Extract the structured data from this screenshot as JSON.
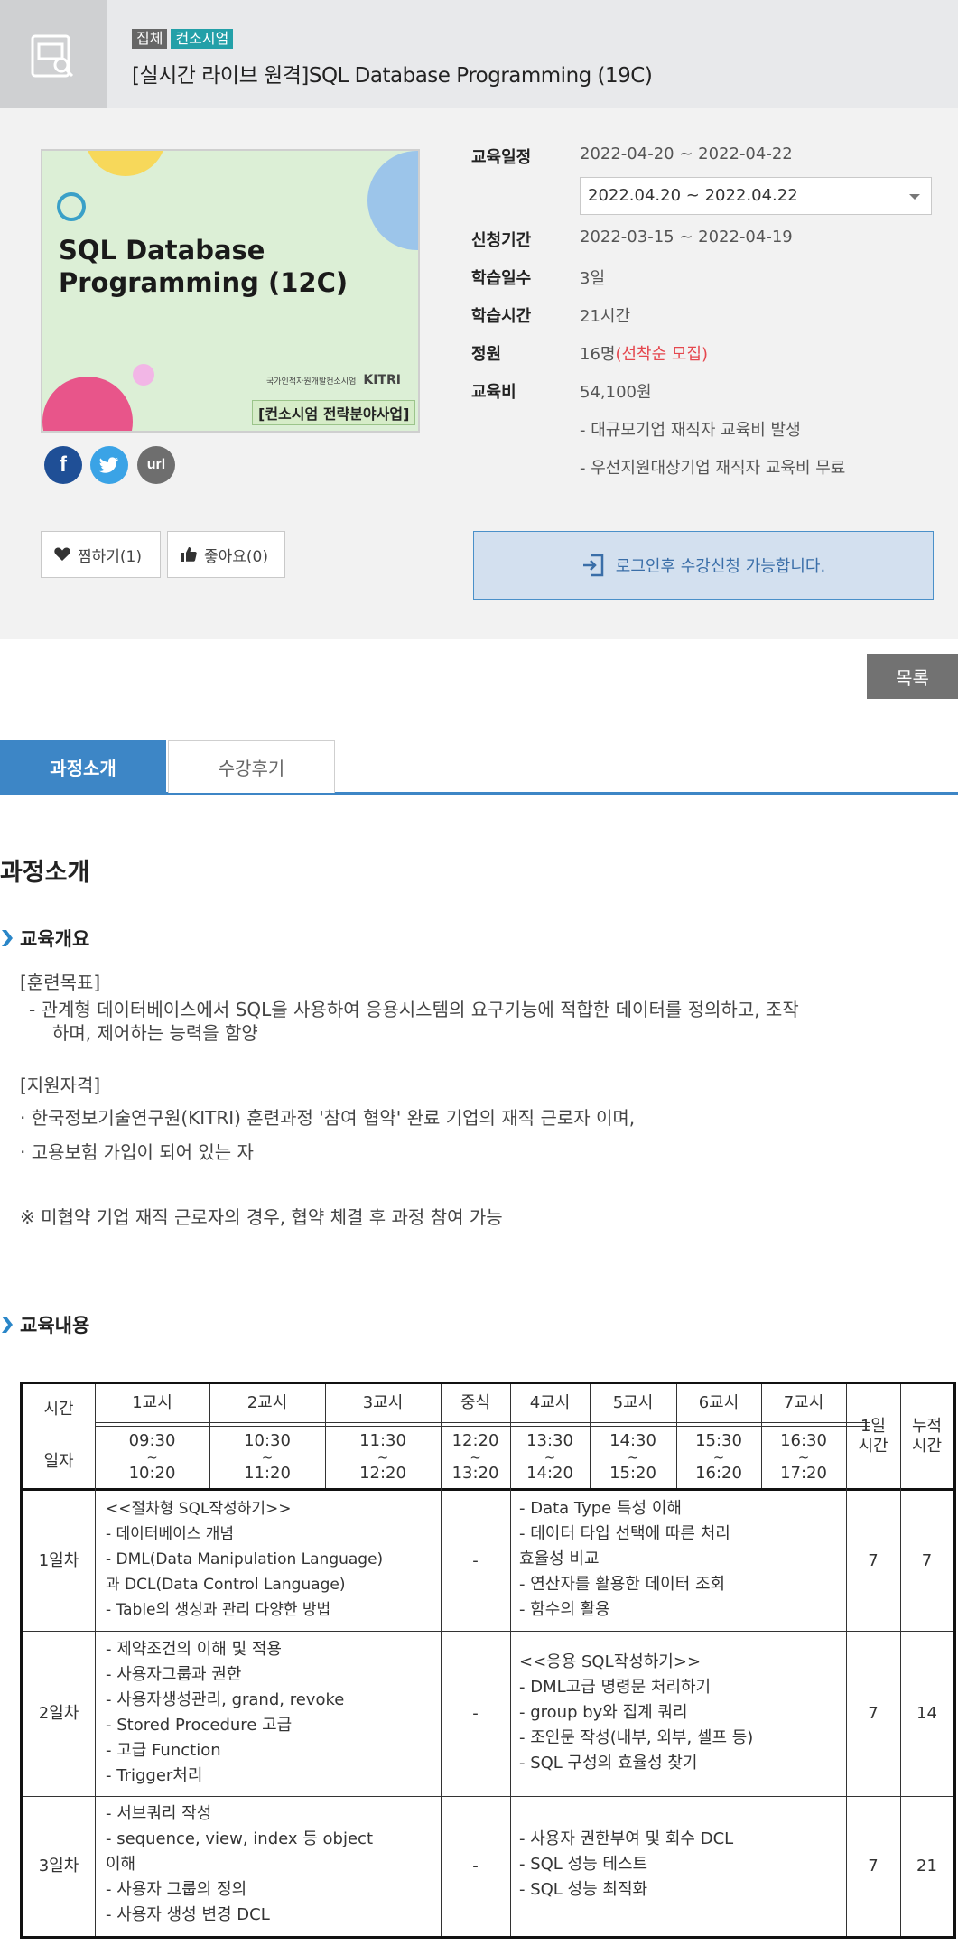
{
  "header": {
    "badge_type": "집체",
    "badge_category": "컨소시엄",
    "title": "[실시간 라이브 원격]SQL Database Programming (19C)"
  },
  "thumbnail": {
    "title": "SQL Database\nProgramming (12C)",
    "logo_text": "국가인적자원개발컨소시엄",
    "logo_kitri": "KITRI",
    "subtitle": "[컨소시엄 전략분야사업]"
  },
  "share": {
    "facebook": "f",
    "twitter": "t",
    "url": "url"
  },
  "actions": {
    "wish": "찜하기(1)",
    "like": "좋아요(0)",
    "login_notice": "로그인후 수강신청 가능합니다.",
    "list": "목록"
  },
  "info": {
    "schedule_label": "교육일정",
    "schedule_value": "2022-04-20 ~ 2022-04-22",
    "schedule_select": "2022.04.20 ~ 2022.04.22",
    "apply_label": "신청기간",
    "apply_value": "2022-03-15 ~ 2022-04-19",
    "days_label": "학습일수",
    "days_value": "3일",
    "hours_label": "학습시간",
    "hours_value": "21시간",
    "capacity_label": "정원",
    "capacity_value": "16명",
    "capacity_note": "(선착순 모집)",
    "fee_label": "교육비",
    "fee_value": "54,100원",
    "fee_note1": "- 대규모기업 재직자 교육비 발생",
    "fee_note2": "- 우선지원대상기업 재직자 교육비 무료"
  },
  "tabs": [
    "과정소개",
    "수강후기"
  ],
  "content": {
    "section_title": "과정소개",
    "overview_head": "교육개요",
    "goal_head": "[훈련목표]",
    "goal_line1": "- 관계형 데이터베이스에서 SQL을 사용하여 응용시스템의 요구기능에 적합한 데이터를 정의하고, 조작",
    "goal_line2": "하며, 제어하는 능력을 함양",
    "qual_head": "[지원자격]",
    "qual_line1": "· 한국정보기술연구원(KITRI) 훈련과정 '참여 협약' 완료 기업의 재직 근로자 이며,",
    "qual_line2": "· 고용보험 가입이 되어 있는 자",
    "note": "※ 미협약 기업 재직 근로자의 경우, 협약 체결 후 과정 참여 가능",
    "content_head": "교육내용"
  },
  "schedule_table": {
    "hdr_time": "시간",
    "hdr_day": "일자",
    "periods": [
      "1교시",
      "2교시",
      "3교시",
      "중식",
      "4교시",
      "5교시",
      "6교시",
      "7교시"
    ],
    "starts": [
      "09:30",
      "10:30",
      "11:30",
      "12:20",
      "13:30",
      "14:30",
      "15:30",
      "16:30"
    ],
    "tilde": "~",
    "ends": [
      "10:20",
      "11:20",
      "12:20",
      "13:20",
      "14:20",
      "15:20",
      "16:20",
      "17:20"
    ],
    "hdr_daily": "1일\n시간",
    "hdr_cumulative": "누적\n시간",
    "rows": [
      {
        "day": "1일차",
        "morning": "<<절차형 SQL작성하기>>\n- 데이터베이스 개념\n- DML(Data Manipulation Language)\n과 DCL(Data Control Language)\n- Table의 생성과 관리 다양한 방법",
        "lunch": "-",
        "afternoon": "- Data Type 특성 이해\n- 데이터 타입 선택에 따른 처리\n효율성 비교\n- 연산자를 활용한 데이터 조회\n- 함수의 활용",
        "daily": "7",
        "cumulative": "7"
      },
      {
        "day": "2일차",
        "morning": "- 제약조건의 이해 및 적용\n- 사용자그룹과 권한\n- 사용자생성관리, grand, revoke\n- Stored Procedure 고급\n- 고급 Function\n- Trigger처리",
        "lunch": "-",
        "afternoon": "<<응용 SQL작성하기>>\n- DML고급 명령문 처리하기\n- group by와 집계 쿼리\n- 조인문 작성(내부, 외부, 셀프 등)\n- SQL 구성의 효율성 찾기",
        "daily": "7",
        "cumulative": "14"
      },
      {
        "day": "3일차",
        "morning": "- 서브쿼리 작성\n- sequence, view, index 등 object\n이해\n- 사용자 그룹의 정의\n- 사용자 생성 변경 DCL",
        "lunch": "-",
        "afternoon": "- 사용자 권한부여 및 회수 DCL\n- SQL 성능 테스트\n- SQL 성능 최적화",
        "daily": "7",
        "cumulative": "21"
      }
    ]
  }
}
